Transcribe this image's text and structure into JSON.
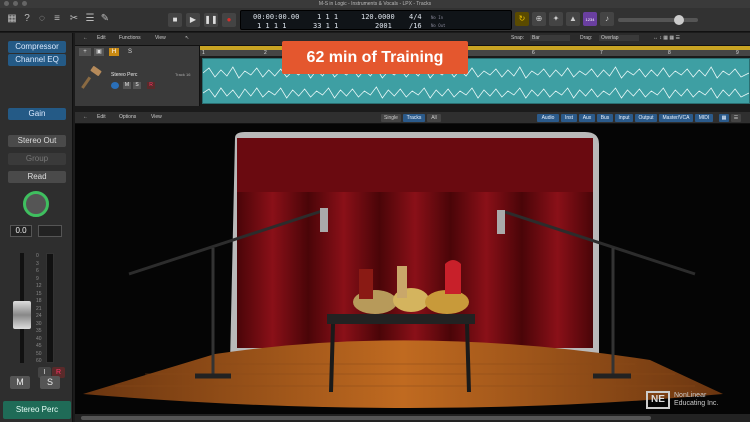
{
  "window": {
    "title": "M-S in Logic - Instruments & Vocals - LPX - Tracks"
  },
  "toolbar": {
    "icons": [
      "library-icon",
      "help-icon",
      "smart-controls-icon",
      "mixer-icon",
      "editors-icon",
      "list-icon",
      "notepad-icon"
    ],
    "lcd": {
      "time_top": "00:00:00.00",
      "time_bottom": "1 1 1 1",
      "bar_top": "1 1 1",
      "bar_bottom": "33 1 1",
      "tempo": "120.0000",
      "tempo_bottom": "2001",
      "sig_top": "4/4",
      "sig_bottom": "/16",
      "in_label": "No In",
      "out_label": "No Out"
    },
    "right_badge": "1234"
  },
  "inspector": {
    "plugins": [
      "Compressor",
      "Channel EQ"
    ],
    "gain_label": "Gain",
    "output": "Stereo Out",
    "group": "Group",
    "automation": "Read",
    "pan_value": "0.0",
    "scale": [
      "0",
      "3",
      "6",
      "9",
      "12",
      "15",
      "18",
      "21",
      "24",
      "30",
      "35",
      "40",
      "45",
      "50",
      "60"
    ],
    "mute": "M",
    "solo": "S",
    "input_btn": "I",
    "record_btn": "R",
    "track_name": "Stereo Perc"
  },
  "tracks": {
    "menu": [
      "Edit",
      "Functions",
      "View"
    ],
    "snap_label": "Snap:",
    "snap_value": "Bar",
    "drag_label": "Drag:",
    "drag_value": "Overlap",
    "track_header": {
      "name": "Stereo Perc",
      "number": "Track 16",
      "mute": "M",
      "solo": "S",
      "h_badge": "H"
    },
    "ruler": [
      "1",
      "2",
      "3",
      "4",
      "5",
      "6",
      "7",
      "8",
      "9"
    ]
  },
  "banner": {
    "text": "62 min of Training"
  },
  "editor": {
    "menu": [
      "Edit",
      "Options",
      "View"
    ],
    "modes": [
      "Single",
      "Tracks",
      "All"
    ],
    "filters": [
      "Audio",
      "Inst",
      "Aux",
      "Bus",
      "Input",
      "Output",
      "Master/VCA",
      "MIDI"
    ]
  },
  "brand": {
    "line1": "NonLinear",
    "line2": "Educating Inc.",
    "logo": "NE"
  }
}
